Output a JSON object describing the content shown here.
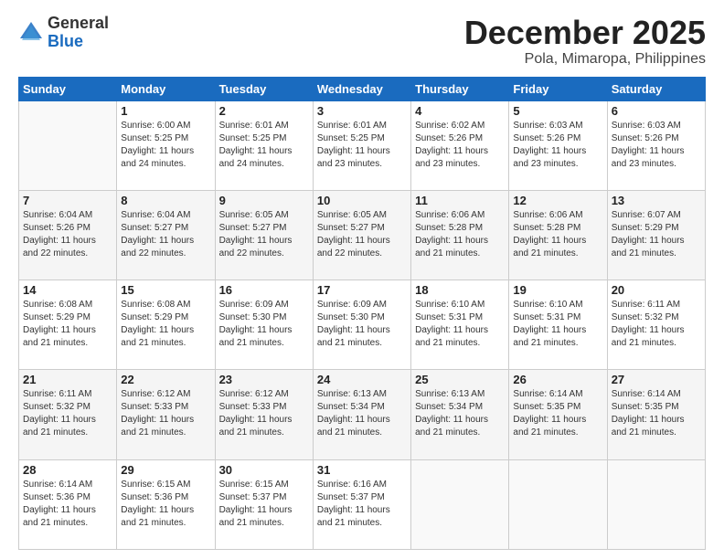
{
  "logo": {
    "general": "General",
    "blue": "Blue"
  },
  "header": {
    "month": "December 2025",
    "location": "Pola, Mimaropa, Philippines"
  },
  "weekdays": [
    "Sunday",
    "Monday",
    "Tuesday",
    "Wednesday",
    "Thursday",
    "Friday",
    "Saturday"
  ],
  "weeks": [
    [
      {
        "day": "",
        "info": ""
      },
      {
        "day": "1",
        "info": "Sunrise: 6:00 AM\nSunset: 5:25 PM\nDaylight: 11 hours\nand 24 minutes."
      },
      {
        "day": "2",
        "info": "Sunrise: 6:01 AM\nSunset: 5:25 PM\nDaylight: 11 hours\nand 24 minutes."
      },
      {
        "day": "3",
        "info": "Sunrise: 6:01 AM\nSunset: 5:25 PM\nDaylight: 11 hours\nand 23 minutes."
      },
      {
        "day": "4",
        "info": "Sunrise: 6:02 AM\nSunset: 5:26 PM\nDaylight: 11 hours\nand 23 minutes."
      },
      {
        "day": "5",
        "info": "Sunrise: 6:03 AM\nSunset: 5:26 PM\nDaylight: 11 hours\nand 23 minutes."
      },
      {
        "day": "6",
        "info": "Sunrise: 6:03 AM\nSunset: 5:26 PM\nDaylight: 11 hours\nand 23 minutes."
      }
    ],
    [
      {
        "day": "7",
        "info": "Sunrise: 6:04 AM\nSunset: 5:26 PM\nDaylight: 11 hours\nand 22 minutes."
      },
      {
        "day": "8",
        "info": "Sunrise: 6:04 AM\nSunset: 5:27 PM\nDaylight: 11 hours\nand 22 minutes."
      },
      {
        "day": "9",
        "info": "Sunrise: 6:05 AM\nSunset: 5:27 PM\nDaylight: 11 hours\nand 22 minutes."
      },
      {
        "day": "10",
        "info": "Sunrise: 6:05 AM\nSunset: 5:27 PM\nDaylight: 11 hours\nand 22 minutes."
      },
      {
        "day": "11",
        "info": "Sunrise: 6:06 AM\nSunset: 5:28 PM\nDaylight: 11 hours\nand 21 minutes."
      },
      {
        "day": "12",
        "info": "Sunrise: 6:06 AM\nSunset: 5:28 PM\nDaylight: 11 hours\nand 21 minutes."
      },
      {
        "day": "13",
        "info": "Sunrise: 6:07 AM\nSunset: 5:29 PM\nDaylight: 11 hours\nand 21 minutes."
      }
    ],
    [
      {
        "day": "14",
        "info": "Sunrise: 6:08 AM\nSunset: 5:29 PM\nDaylight: 11 hours\nand 21 minutes."
      },
      {
        "day": "15",
        "info": "Sunrise: 6:08 AM\nSunset: 5:29 PM\nDaylight: 11 hours\nand 21 minutes."
      },
      {
        "day": "16",
        "info": "Sunrise: 6:09 AM\nSunset: 5:30 PM\nDaylight: 11 hours\nand 21 minutes."
      },
      {
        "day": "17",
        "info": "Sunrise: 6:09 AM\nSunset: 5:30 PM\nDaylight: 11 hours\nand 21 minutes."
      },
      {
        "day": "18",
        "info": "Sunrise: 6:10 AM\nSunset: 5:31 PM\nDaylight: 11 hours\nand 21 minutes."
      },
      {
        "day": "19",
        "info": "Sunrise: 6:10 AM\nSunset: 5:31 PM\nDaylight: 11 hours\nand 21 minutes."
      },
      {
        "day": "20",
        "info": "Sunrise: 6:11 AM\nSunset: 5:32 PM\nDaylight: 11 hours\nand 21 minutes."
      }
    ],
    [
      {
        "day": "21",
        "info": "Sunrise: 6:11 AM\nSunset: 5:32 PM\nDaylight: 11 hours\nand 21 minutes."
      },
      {
        "day": "22",
        "info": "Sunrise: 6:12 AM\nSunset: 5:33 PM\nDaylight: 11 hours\nand 21 minutes."
      },
      {
        "day": "23",
        "info": "Sunrise: 6:12 AM\nSunset: 5:33 PM\nDaylight: 11 hours\nand 21 minutes."
      },
      {
        "day": "24",
        "info": "Sunrise: 6:13 AM\nSunset: 5:34 PM\nDaylight: 11 hours\nand 21 minutes."
      },
      {
        "day": "25",
        "info": "Sunrise: 6:13 AM\nSunset: 5:34 PM\nDaylight: 11 hours\nand 21 minutes."
      },
      {
        "day": "26",
        "info": "Sunrise: 6:14 AM\nSunset: 5:35 PM\nDaylight: 11 hours\nand 21 minutes."
      },
      {
        "day": "27",
        "info": "Sunrise: 6:14 AM\nSunset: 5:35 PM\nDaylight: 11 hours\nand 21 minutes."
      }
    ],
    [
      {
        "day": "28",
        "info": "Sunrise: 6:14 AM\nSunset: 5:36 PM\nDaylight: 11 hours\nand 21 minutes."
      },
      {
        "day": "29",
        "info": "Sunrise: 6:15 AM\nSunset: 5:36 PM\nDaylight: 11 hours\nand 21 minutes."
      },
      {
        "day": "30",
        "info": "Sunrise: 6:15 AM\nSunset: 5:37 PM\nDaylight: 11 hours\nand 21 minutes."
      },
      {
        "day": "31",
        "info": "Sunrise: 6:16 AM\nSunset: 5:37 PM\nDaylight: 11 hours\nand 21 minutes."
      },
      {
        "day": "",
        "info": ""
      },
      {
        "day": "",
        "info": ""
      },
      {
        "day": "",
        "info": ""
      }
    ]
  ]
}
